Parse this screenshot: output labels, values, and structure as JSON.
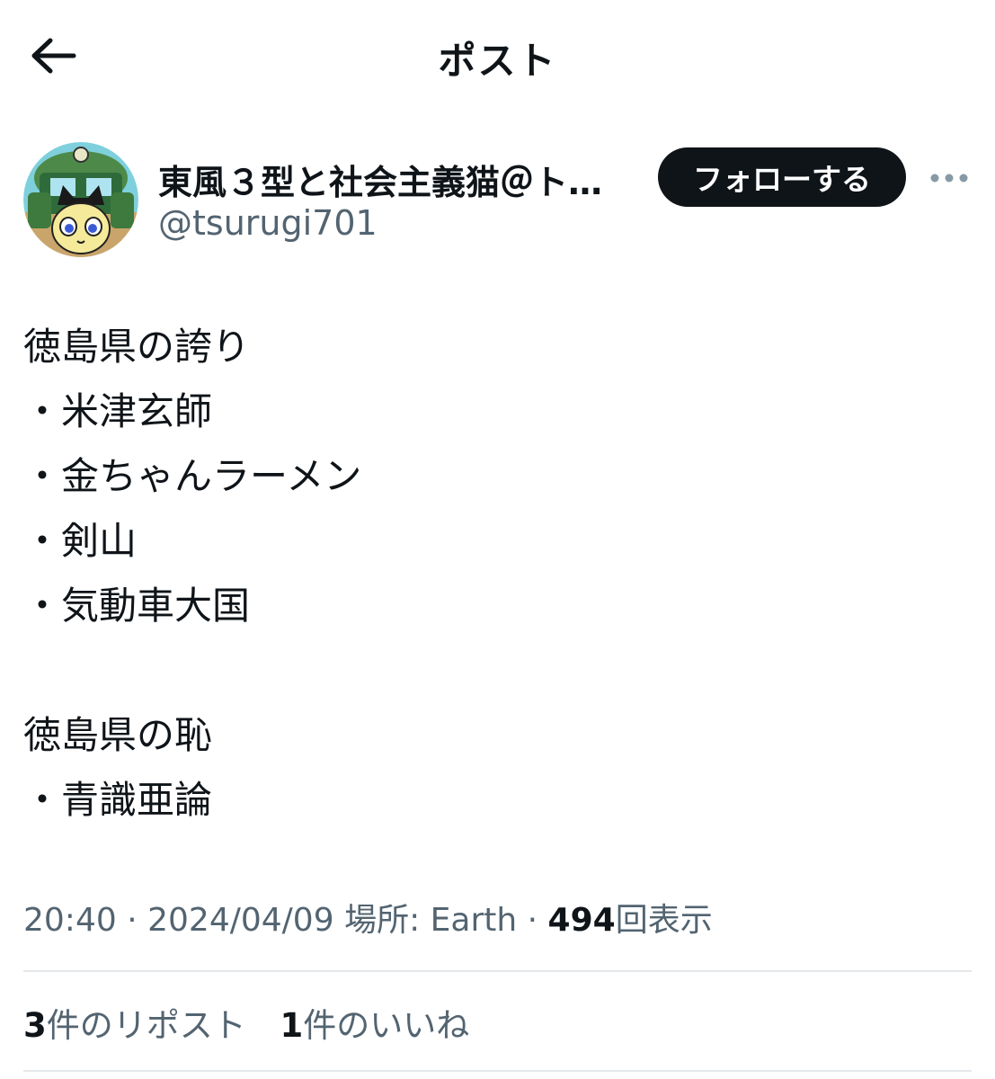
{
  "header": {
    "title": "ポスト",
    "back_icon": "arrow-left-icon"
  },
  "author": {
    "display_name": "東風３型と社会主義猫＠ト…",
    "handle": "@tsurugi701",
    "follow_label": "フォローする",
    "more_icon": "more-horizontal-icon",
    "avatar_icon": "avatar-cat-train-image"
  },
  "post": {
    "lines": [
      "徳島県の誇り",
      "・米津玄師",
      "・金ちゃんラーメン",
      "・剣山",
      "・気動車大国",
      "",
      "徳島県の恥",
      "・青識亜論"
    ]
  },
  "meta": {
    "time": "20:40",
    "date": "2024/04/09",
    "location": "場所: Earth",
    "views_count": "494",
    "views_label": "回表示",
    "separator": "·"
  },
  "stats": {
    "reposts_count": "3",
    "reposts_label": "件のリポスト",
    "likes_count": "1",
    "likes_label": "件のいいね"
  },
  "colors": {
    "text_primary": "#0f1419",
    "text_secondary": "#536471",
    "divider": "#e4e8eb",
    "button_bg": "#0f1419"
  }
}
